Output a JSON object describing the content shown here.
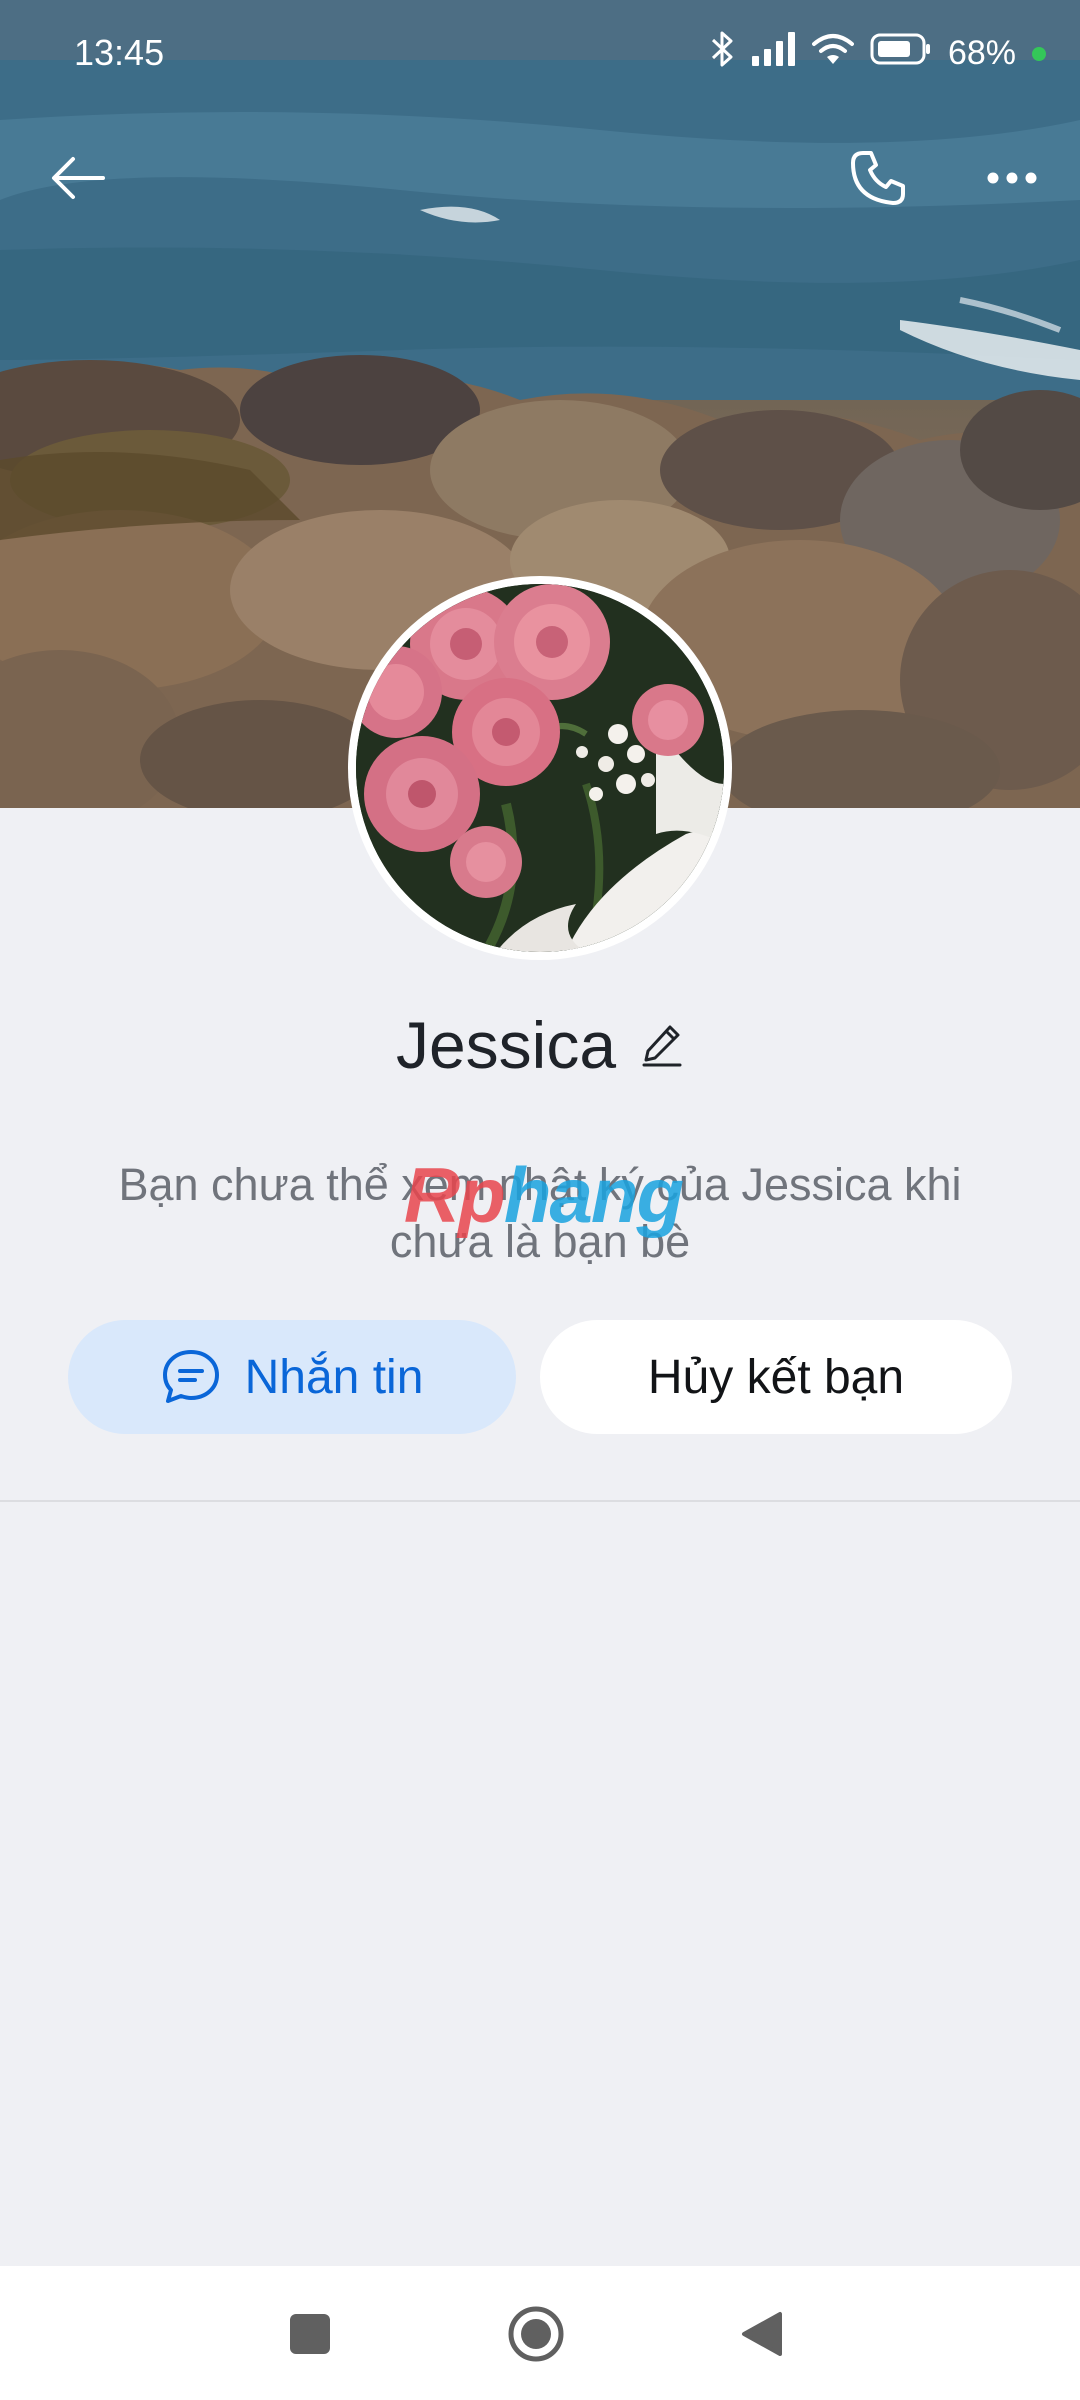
{
  "status_bar": {
    "time": "13:45",
    "battery_percent": "68%",
    "icons": [
      "bluetooth-icon",
      "signal-icon",
      "wifi-icon",
      "battery-icon"
    ]
  },
  "header": {
    "icons": [
      "back-arrow-icon",
      "phone-icon",
      "more-dots-icon"
    ]
  },
  "profile": {
    "name": "Jessica",
    "info": "Bạn chưa thể xem nhật ký của Jessica khi chưa là bạn bè"
  },
  "actions": {
    "message_label": "Nhắn tin",
    "unfriend_label": "Hủy kết bạn"
  },
  "watermark": {
    "part_a": "Rp",
    "part_b": "hang"
  },
  "colors": {
    "accent": "#0a66d8",
    "message_button_bg": "#d9e8fb",
    "page_bg": "#eff0f4"
  }
}
